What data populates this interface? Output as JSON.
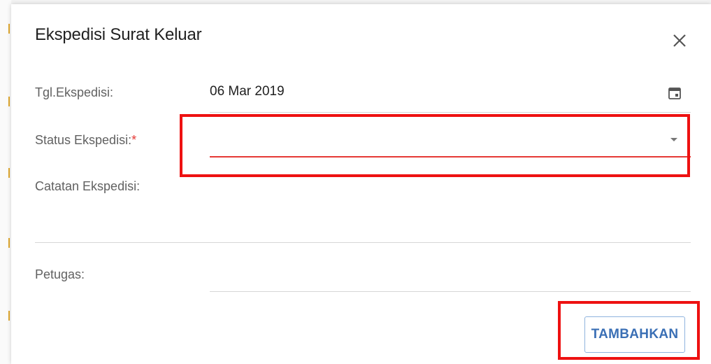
{
  "dialog": {
    "title": "Ekspedisi Surat Keluar"
  },
  "fields": {
    "tgl_label": "Tgl.Ekspedisi:",
    "tgl_value": "06 Mar 2019",
    "status_label": "Status Ekspedisi:",
    "status_required_mark": "*",
    "status_value": "",
    "catatan_label": "Catatan Ekspedisi:",
    "catatan_value": "",
    "petugas_label": "Petugas:",
    "petugas_value": ""
  },
  "actions": {
    "submit_label": "TAMBAHKAN"
  },
  "icons": {
    "close": "close-icon",
    "calendar": "calendar-icon",
    "dropdown": "chevron-down-icon"
  },
  "colors": {
    "accent_button": "#3a6fb5",
    "error_red": "#e53935",
    "highlight_red": "#ee1111"
  }
}
